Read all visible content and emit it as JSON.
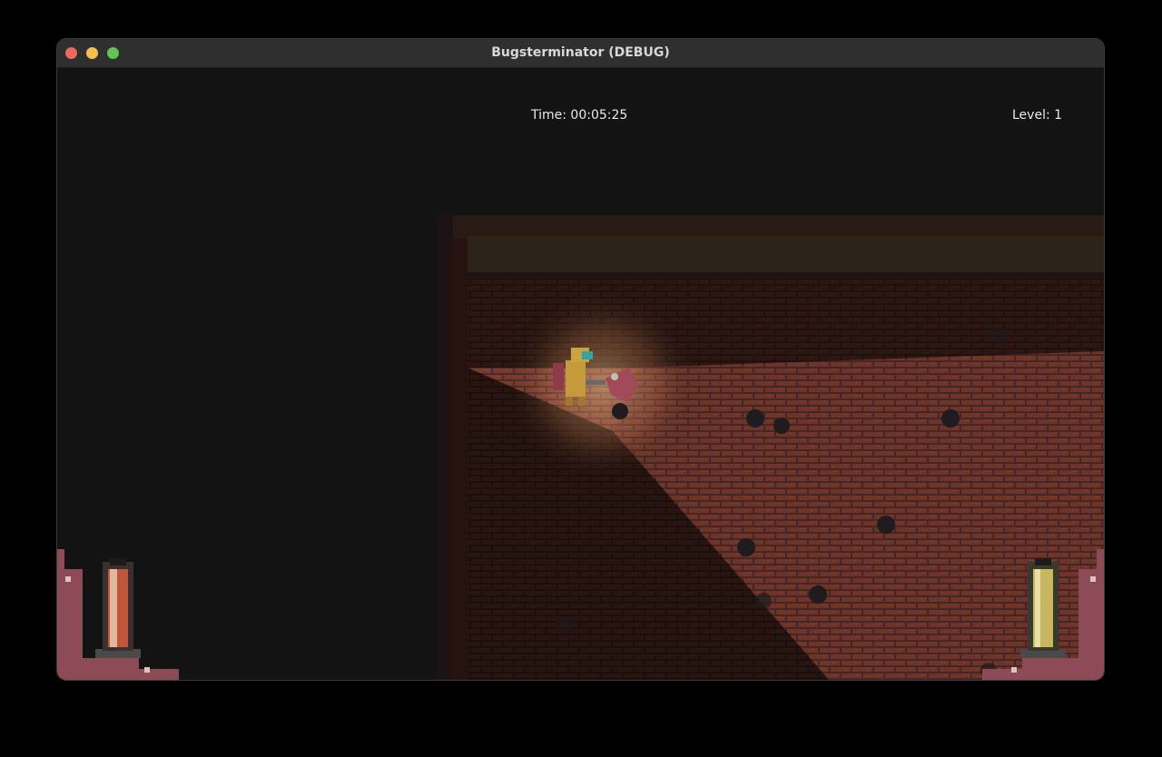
{
  "window": {
    "title": "Bugsterminator (DEBUG)"
  },
  "hud": {
    "time": "Time: 00:05:25",
    "level": "Level: 1"
  },
  "colors": {
    "brick": "#7a3b2b",
    "mortar": "#4a2a2f",
    "health_fill": "#c0563a",
    "ammo_fill": "#c8b660",
    "hud_frame": "#8c4b56"
  },
  "gauges": {
    "left_level": 0.9,
    "right_level": 0.9
  }
}
